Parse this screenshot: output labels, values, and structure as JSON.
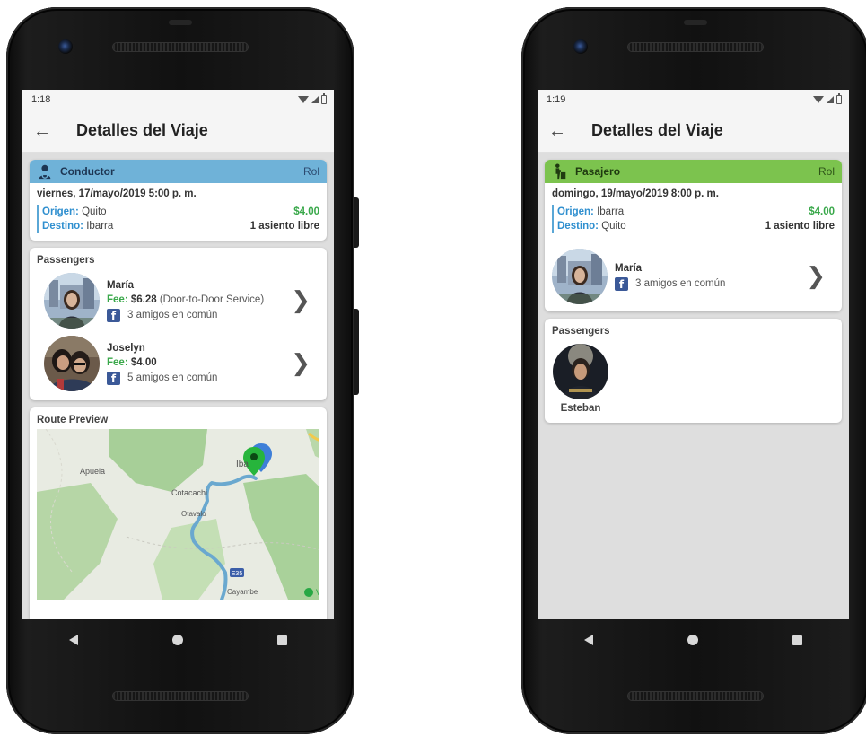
{
  "colors": {
    "driver_role_bg": "#6fb2d8",
    "passenger_role_bg": "#7cc34e",
    "label_blue": "#2f8fcf",
    "price_green": "#39a84a",
    "facebook_blue": "#3b5998",
    "route_line": "#6aa8cf"
  },
  "phone1": {
    "status_time": "1:18",
    "back_icon": "arrow-left-icon",
    "app_title": "Detalles del Viaje",
    "role": {
      "icon": "driver-icon",
      "label": "Conductor",
      "right": "Rol"
    },
    "trip": {
      "date": "viernes, 17/mayo/2019   5:00 p. m.",
      "origin_label": "Origen:",
      "origin": "Quito",
      "destination_label": "Destino:",
      "destination": "Ibarra",
      "price": "$4.00",
      "seats": "1 asiento libre"
    },
    "passengers_title": "Passengers",
    "passengers": [
      {
        "name": "María",
        "fee_label": "Fee:",
        "fee": "$6.28",
        "fee_note": "(Door-to-Door Service)",
        "friends": "3 amigos en común"
      },
      {
        "name": "Joselyn",
        "fee_label": "Fee:",
        "fee": "$4.00",
        "fee_note": "",
        "friends": "5 amigos en común"
      }
    ],
    "route_title": "Route Preview",
    "map_labels": {
      "apuela": "Apuela",
      "cotacachi": "Cotacachi",
      "otavalo": "Otavalo",
      "ibarra": "Iba",
      "cayambe": "Cayambe",
      "highway": "E35",
      "corner": "Vi"
    }
  },
  "phone2": {
    "status_time": "1:19",
    "back_icon": "arrow-left-icon",
    "app_title": "Detalles del Viaje",
    "role": {
      "icon": "passenger-icon",
      "label": "Pasajero",
      "right": "Rol"
    },
    "trip": {
      "date": "domingo, 19/mayo/2019   8:00 p. m.",
      "origin_label": "Origen:",
      "origin": "Ibarra",
      "destination_label": "Destino:",
      "destination": "Quito",
      "price": "$4.00",
      "seats": "1 asiento libre"
    },
    "driver": {
      "name": "María",
      "friends": "3 amigos en común"
    },
    "passengers_title": "Passengers",
    "passengers": [
      {
        "name": "Esteban"
      }
    ]
  }
}
